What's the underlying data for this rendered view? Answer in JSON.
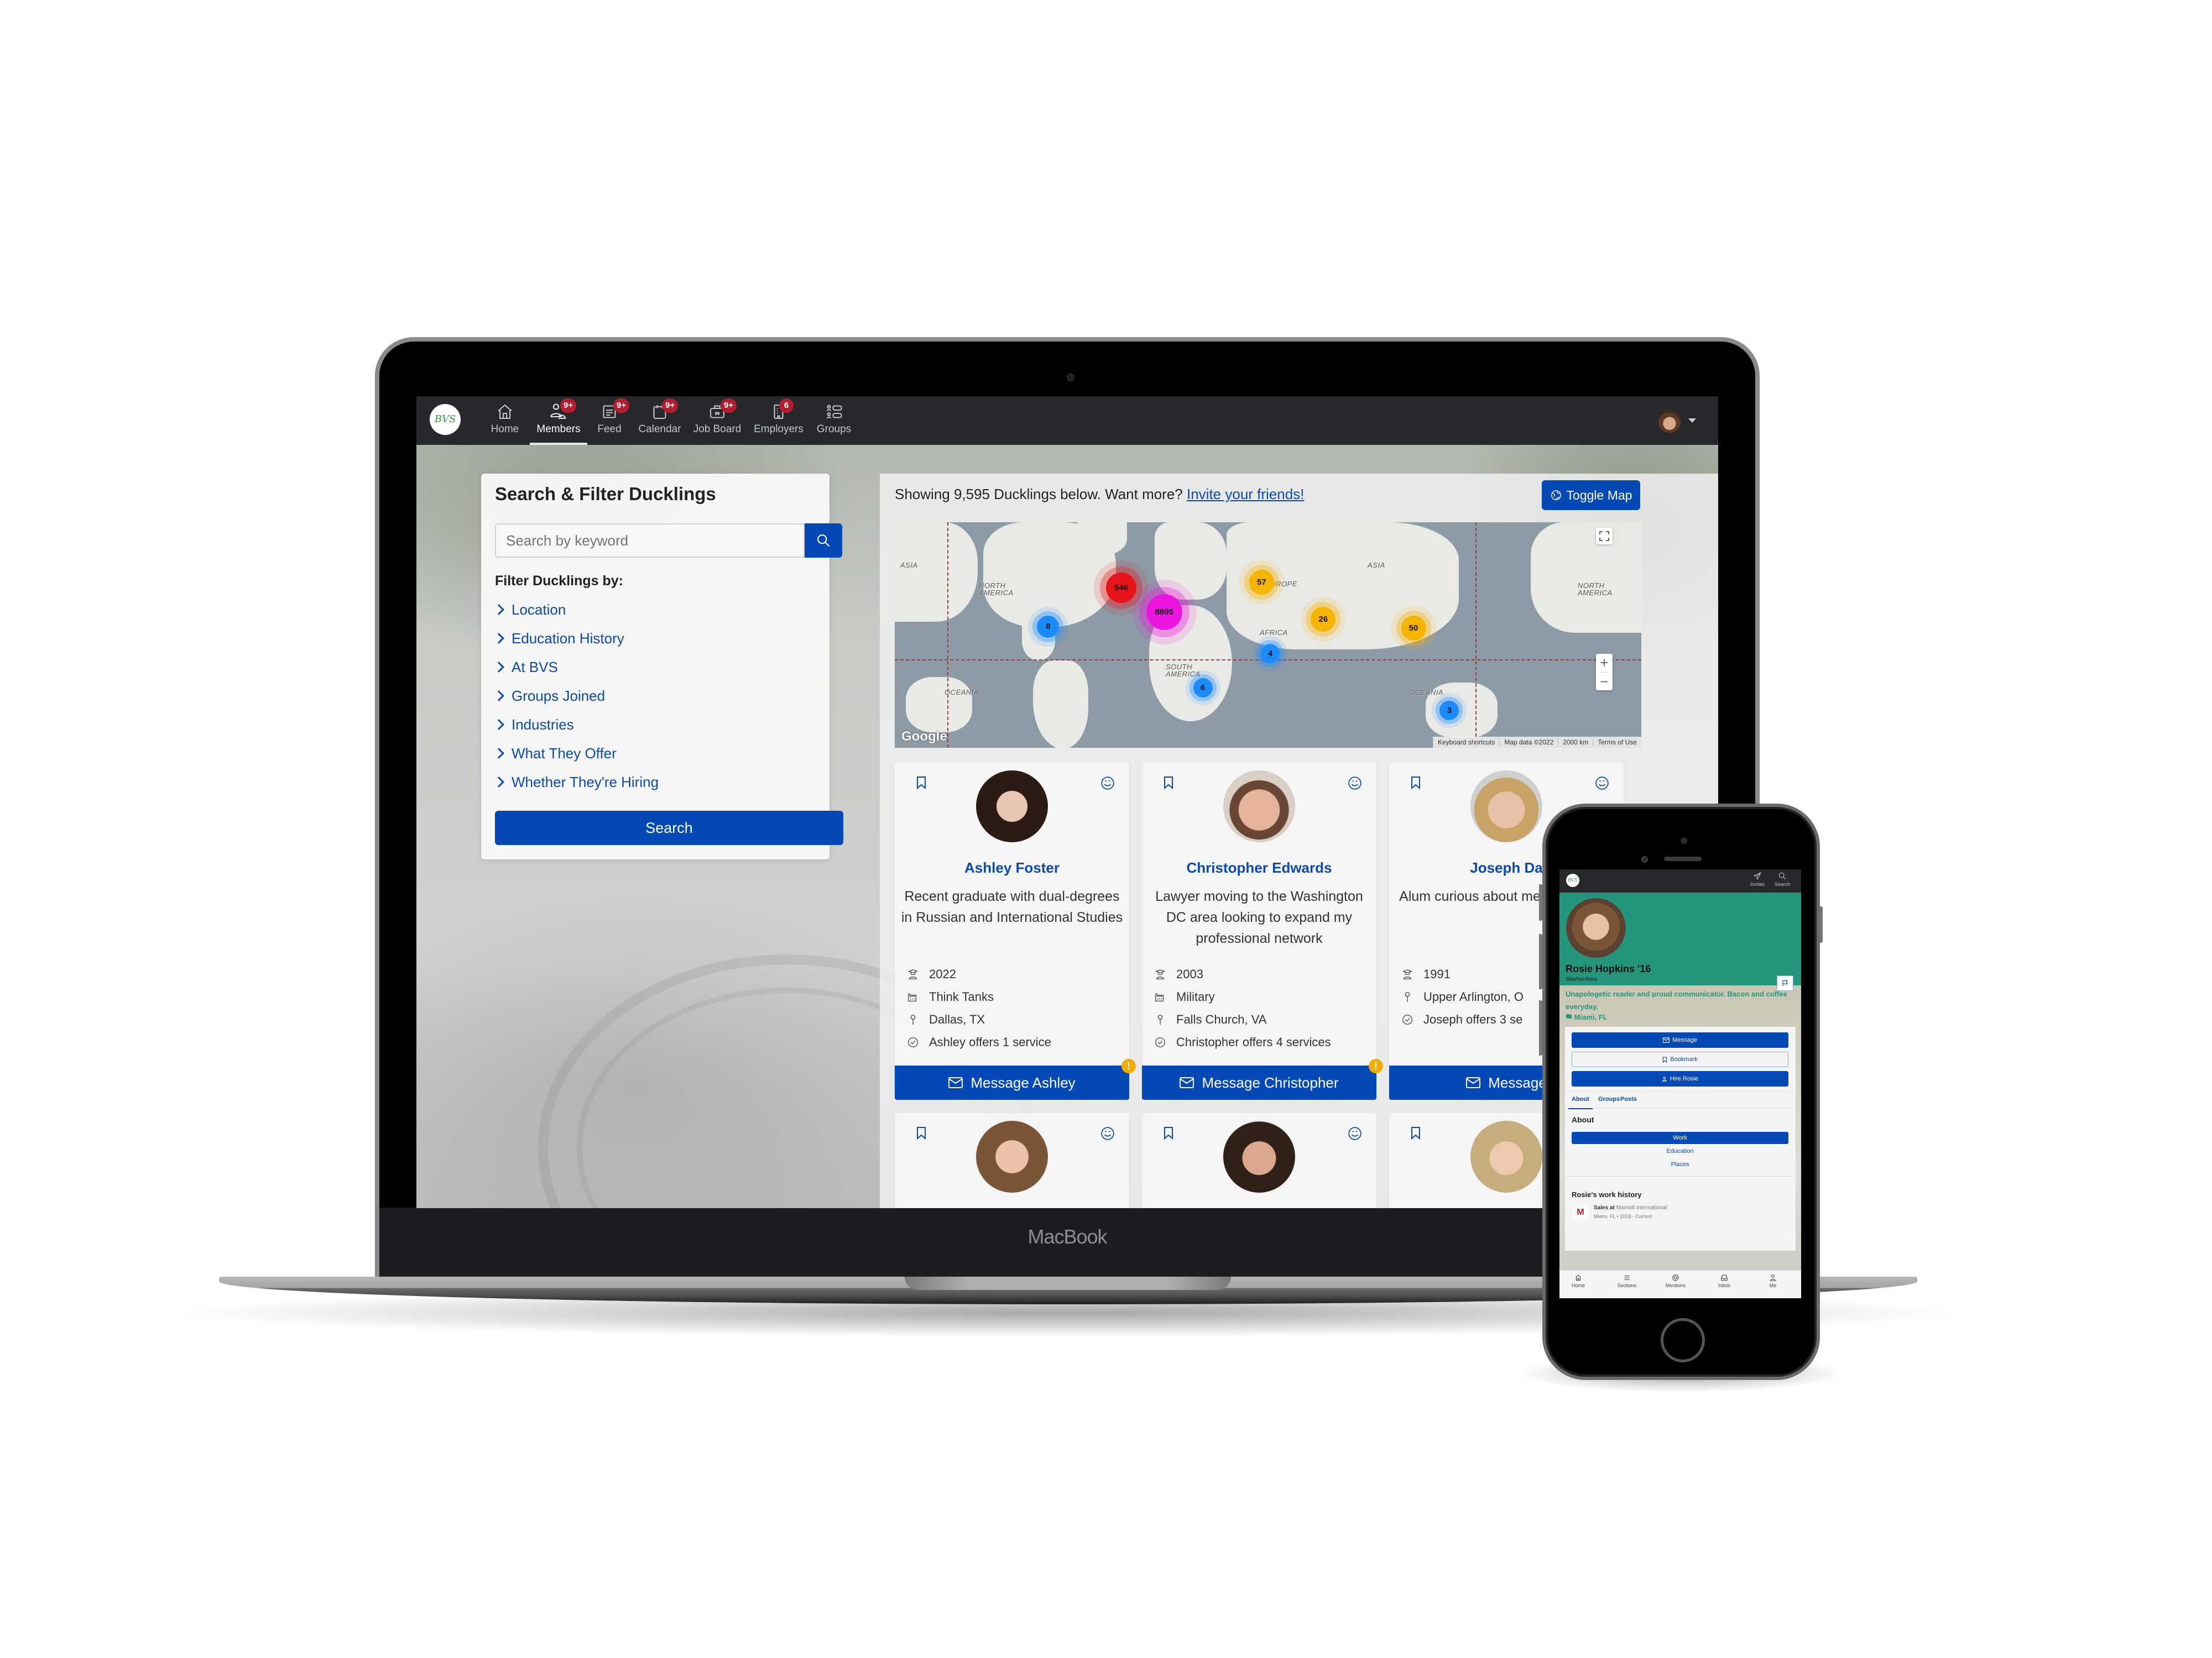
{
  "device": {
    "laptop_label": "MacBook"
  },
  "nav": {
    "logo_text": "BVS",
    "items": [
      {
        "label": "Home",
        "icon": "home-icon",
        "badge": null,
        "active": false
      },
      {
        "label": "Members",
        "icon": "members-icon",
        "badge": "9+",
        "active": true
      },
      {
        "label": "Feed",
        "icon": "feed-icon",
        "badge": "9+",
        "active": false
      },
      {
        "label": "Calendar",
        "icon": "calendar-icon",
        "badge": "9+",
        "active": false
      },
      {
        "label": "Job Board",
        "icon": "job-board-icon",
        "badge": "9+",
        "active": false
      },
      {
        "label": "Employers",
        "icon": "employers-icon",
        "badge": "6",
        "active": false
      },
      {
        "label": "Groups",
        "icon": "groups-icon",
        "badge": null,
        "active": false
      }
    ]
  },
  "filter": {
    "title": "Search & Filter Ducklings",
    "search_placeholder": "Search by keyword",
    "search_value": "",
    "subtitle": "Filter Ducklings by:",
    "links": [
      "Location",
      "Education History",
      "At BVS",
      "Groups Joined",
      "Industries",
      "What They Offer",
      "Whether They're Hiring"
    ],
    "submit_label": "Search"
  },
  "results": {
    "summary": "Showing 9,595 Ducklings below. Want more?",
    "invite_link": "Invite your friends!",
    "toggle_map_label": "Toggle Map"
  },
  "map": {
    "labels": {
      "asia_left": "ASIA",
      "north_america": "NORTH AMERICA",
      "europe": "EUROPE",
      "asia_right": "ASIA",
      "north_america_right": "NORTH AMERICA",
      "africa": "AFRICA",
      "south_america": "SOUTH AMERICA",
      "oceania_left": "OCEANIA",
      "oceania_right": "OCEANIA"
    },
    "clusters": [
      {
        "count": "546",
        "color": "#e8141b"
      },
      {
        "count": "8895",
        "color": "#ee14e0"
      },
      {
        "count": "8",
        "color": "#1a8cff"
      },
      {
        "count": "57",
        "color": "#f4b400"
      },
      {
        "count": "26",
        "color": "#f4b400"
      },
      {
        "count": "50",
        "color": "#f4b400"
      },
      {
        "count": "4",
        "color": "#1a8cff"
      },
      {
        "count": "6",
        "color": "#1a8cff"
      },
      {
        "count": "3",
        "color": "#1a8cff"
      }
    ],
    "google_label": "Google",
    "footer": [
      "Keyboard shortcuts",
      "Map data ©2022",
      "2000 km",
      "Terms of Use"
    ],
    "zoom_in": "+",
    "zoom_out": "−"
  },
  "members": [
    {
      "name": "Ashley Foster",
      "bio": "Recent graduate with dual-degrees in Russian and International Studies",
      "year": "2022",
      "industry": "Think Tanks",
      "location": "Dallas, TX",
      "services": "Ashley offers 1 service",
      "message_label": "Message Ashley",
      "alert": true
    },
    {
      "name": "Christopher Edwards",
      "bio": "Lawyer moving to the Washington DC area looking to expand my professional network",
      "year": "2003",
      "industry": "Military",
      "location": "Falls Church, VA",
      "services": "Christopher offers 4 services",
      "message_label": "Message Christopher",
      "alert": true
    },
    {
      "name": "Joseph Da",
      "bio": "Alum curious about memories from",
      "year": "1991",
      "industry": null,
      "location": "Upper Arlington, O",
      "services": "Joseph offers 3 se",
      "message_label": "Message",
      "alert": false
    }
  ],
  "phone": {
    "nav": {
      "invites_label": "Invites",
      "search_label": "Search"
    },
    "profile": {
      "name": "Rosie Hopkins '16",
      "pronouns": "She/her/hers",
      "bio": "Unapologetic reader and proud communicator. Bacon and coffee everyday.",
      "location": "Miami, FL",
      "buttons": {
        "message": "Message",
        "bookmark": "Bookmark",
        "hire": "Hire Rosie"
      },
      "tabs": [
        "About",
        "Groups",
        "Posts"
      ],
      "active_tab": "About",
      "about_title": "About",
      "about_sections": [
        "Work",
        "Education",
        "Places"
      ],
      "active_section": "Work",
      "work_history_title": "Rosie's work history",
      "work": {
        "role": "Sales at",
        "company": "Marriott International",
        "location": "Miami, FL",
        "dates": "2018 - Current",
        "logo_letter": "M"
      }
    },
    "tabbar": [
      "Home",
      "Sections",
      "Mentions",
      "Inbox",
      "Me"
    ]
  }
}
